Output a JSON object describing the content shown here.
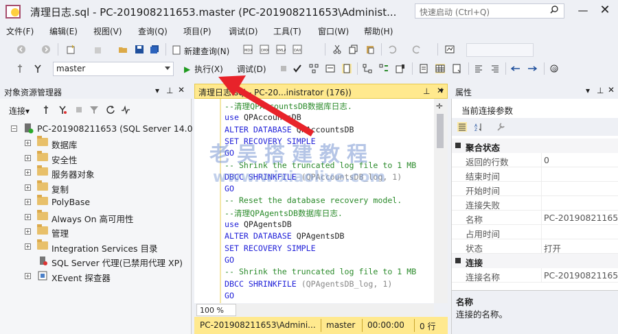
{
  "window": {
    "title": "清理日志.sql - PC-201908211653.master (PC-201908211653\\Administ...",
    "quick_launch_placeholder": "快速启动 (Ctrl+Q)",
    "minimize": "—",
    "close": "✕"
  },
  "menu": [
    "文件(F)",
    "编辑(E)",
    "视图(V)",
    "查询(Q)",
    "项目(P)",
    "调试(D)",
    "工具(T)",
    "窗口(W)",
    "帮助(H)"
  ],
  "toolbar": {
    "new_query": "新建查询(N)",
    "database": "master",
    "execute": "执行(X)",
    "debug": "调试(D)"
  },
  "object_explorer": {
    "title": "对象资源管理器",
    "connect": "连接▾",
    "server": "PC-201908211653 (SQL Server 14.0",
    "nodes": [
      "数据库",
      "安全性",
      "服务器对象",
      "复制",
      "PolyBase",
      "Always On 高可用性",
      "管理",
      "Integration Services 目录",
      "SQL Server 代理(已禁用代理 XP)",
      "XEvent 探查器"
    ]
  },
  "editor": {
    "tab_title": "清理日志.sql - PC-20...inistrator (176))",
    "lines": [
      {
        "t": "--清理QPAccountsDB数据库日志.",
        "c": "c-cmt"
      },
      {
        "t": "use QPAccountsDB",
        "c": "mix-use"
      },
      {
        "t": "ALTER DATABASE QPAccountsDB",
        "c": "mix-alter"
      },
      {
        "t": "SET RECOVERY SIMPLE",
        "c": "c-kw"
      },
      {
        "t": "GO",
        "c": "c-kw"
      },
      {
        "t": "-- Shrink the truncated log file to 1 MB",
        "c": "c-cmt"
      },
      {
        "t": "DBCC SHRINKFILE (QPAccountsDB_log, 1)",
        "c": "mix-dbcc"
      },
      {
        "t": "GO",
        "c": "c-kw"
      },
      {
        "t": "-- Reset the database recovery model.",
        "c": "c-cmt"
      },
      {
        "t": "--清理QPAgentsDB数据库日志.",
        "c": "c-cmt"
      },
      {
        "t": "use QPAgentsDB",
        "c": "mix-use"
      },
      {
        "t": "ALTER DATABASE QPAgentsDB",
        "c": "mix-alter"
      },
      {
        "t": "SET RECOVERY SIMPLE",
        "c": "c-kw"
      },
      {
        "t": "GO",
        "c": "c-kw"
      },
      {
        "t": "-- Shrink the truncated log file to 1 MB",
        "c": "c-cmt"
      },
      {
        "t": "DBCC SHRINKFILE (QPAgentsDB_log, 1)",
        "c": "mix-dbcc"
      },
      {
        "t": "GO",
        "c": "c-kw"
      }
    ],
    "zoom": "100 %",
    "status": {
      "server": "PC-201908211653\\Admini...",
      "db": "master",
      "time": "00:00:00",
      "rows": "0 行"
    }
  },
  "properties": {
    "title": "属性",
    "subtitle": "当前连接参数",
    "groups": [
      {
        "name": "聚合状态",
        "rows": [
          [
            "返回的行数",
            "0"
          ],
          [
            "结束时间",
            ""
          ],
          [
            "开始时间",
            ""
          ],
          [
            "连接失败",
            ""
          ],
          [
            "名称",
            "PC-201908211653"
          ],
          [
            "占用时间",
            ""
          ],
          [
            "状态",
            "打开"
          ]
        ]
      },
      {
        "name": "连接",
        "rows": [
          [
            "连接名称",
            "PC-201908211653"
          ]
        ]
      }
    ],
    "desc_title": "名称",
    "desc_text": "连接的名称。"
  },
  "watermark": {
    "line1": "老吴搭建教程",
    "line2": "www.wixiaolive.com"
  },
  "colors": {
    "accent": "#ffe98e",
    "keyword": "#1f1fd8",
    "comment": "#2a8a2a",
    "arrow": "#e8232a"
  }
}
